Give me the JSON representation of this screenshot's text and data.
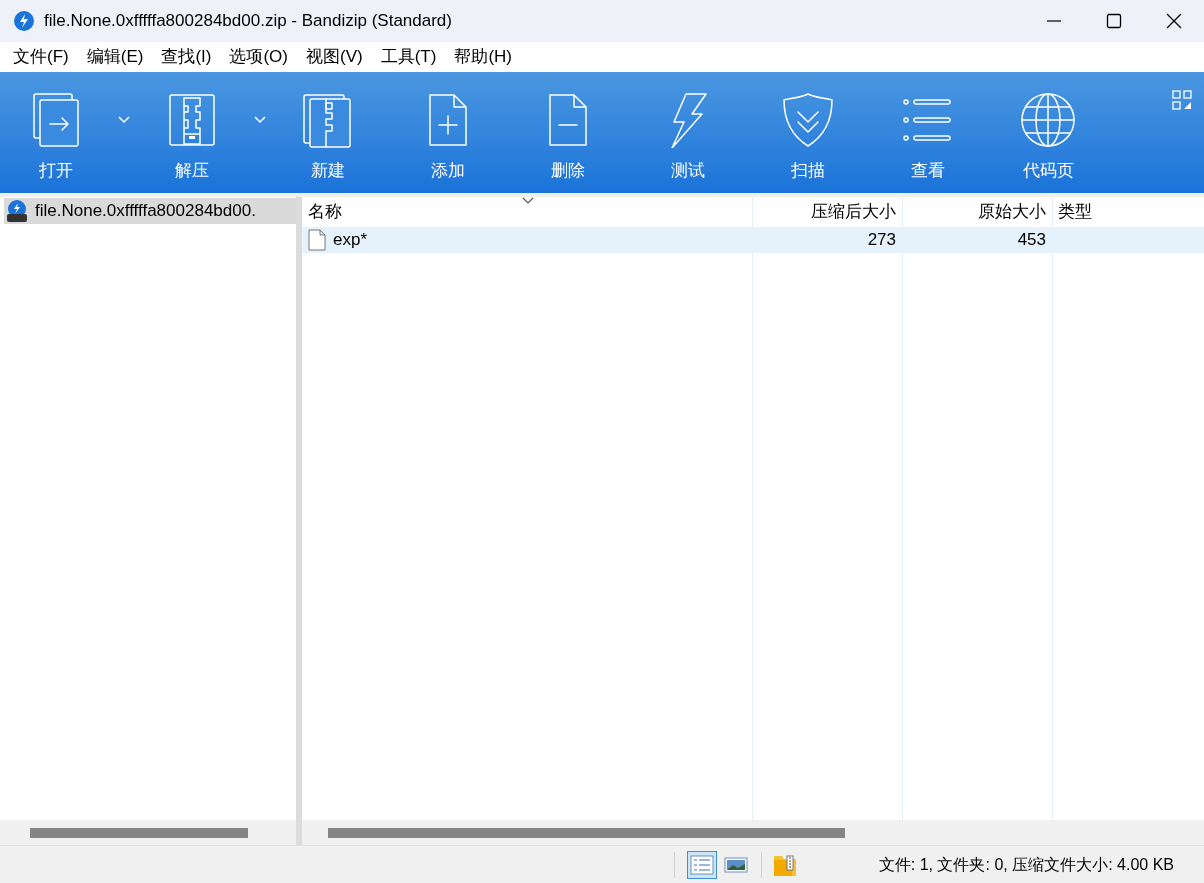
{
  "window": {
    "title": "file.None.0xfffffa800284bd00.zip - Bandizip (Standard)"
  },
  "menu": [
    "文件(F)",
    "编辑(E)",
    "查找(I)",
    "选项(O)",
    "视图(V)",
    "工具(T)",
    "帮助(H)"
  ],
  "toolbar": [
    {
      "label": "打开",
      "kind": "open",
      "has_dropdown": true
    },
    {
      "label": "解压",
      "kind": "extract",
      "has_dropdown": true
    },
    {
      "label": "新建",
      "kind": "new"
    },
    {
      "label": "添加",
      "kind": "add"
    },
    {
      "label": "删除",
      "kind": "delete"
    },
    {
      "label": "测试",
      "kind": "test"
    },
    {
      "label": "扫描",
      "kind": "scan"
    },
    {
      "label": "查看",
      "kind": "view"
    },
    {
      "label": "代码页",
      "kind": "codepage"
    }
  ],
  "tree": {
    "items": [
      {
        "label": "file.None.0xfffffa800284bd00.",
        "selected": true
      }
    ]
  },
  "table": {
    "columns": [
      "名称",
      "压缩后大小",
      "原始大小",
      "类型"
    ],
    "rows": [
      {
        "name": "exp*",
        "compressed": "273",
        "original": "453",
        "selected": true
      }
    ]
  },
  "status_bar": {
    "view_buttons": [
      {
        "kind": "details",
        "selected": true
      },
      {
        "kind": "thumbnails",
        "selected": false
      }
    ],
    "text": "文件: 1, 文件夹: 0, 压缩文件大小: 4.00 KB"
  }
}
